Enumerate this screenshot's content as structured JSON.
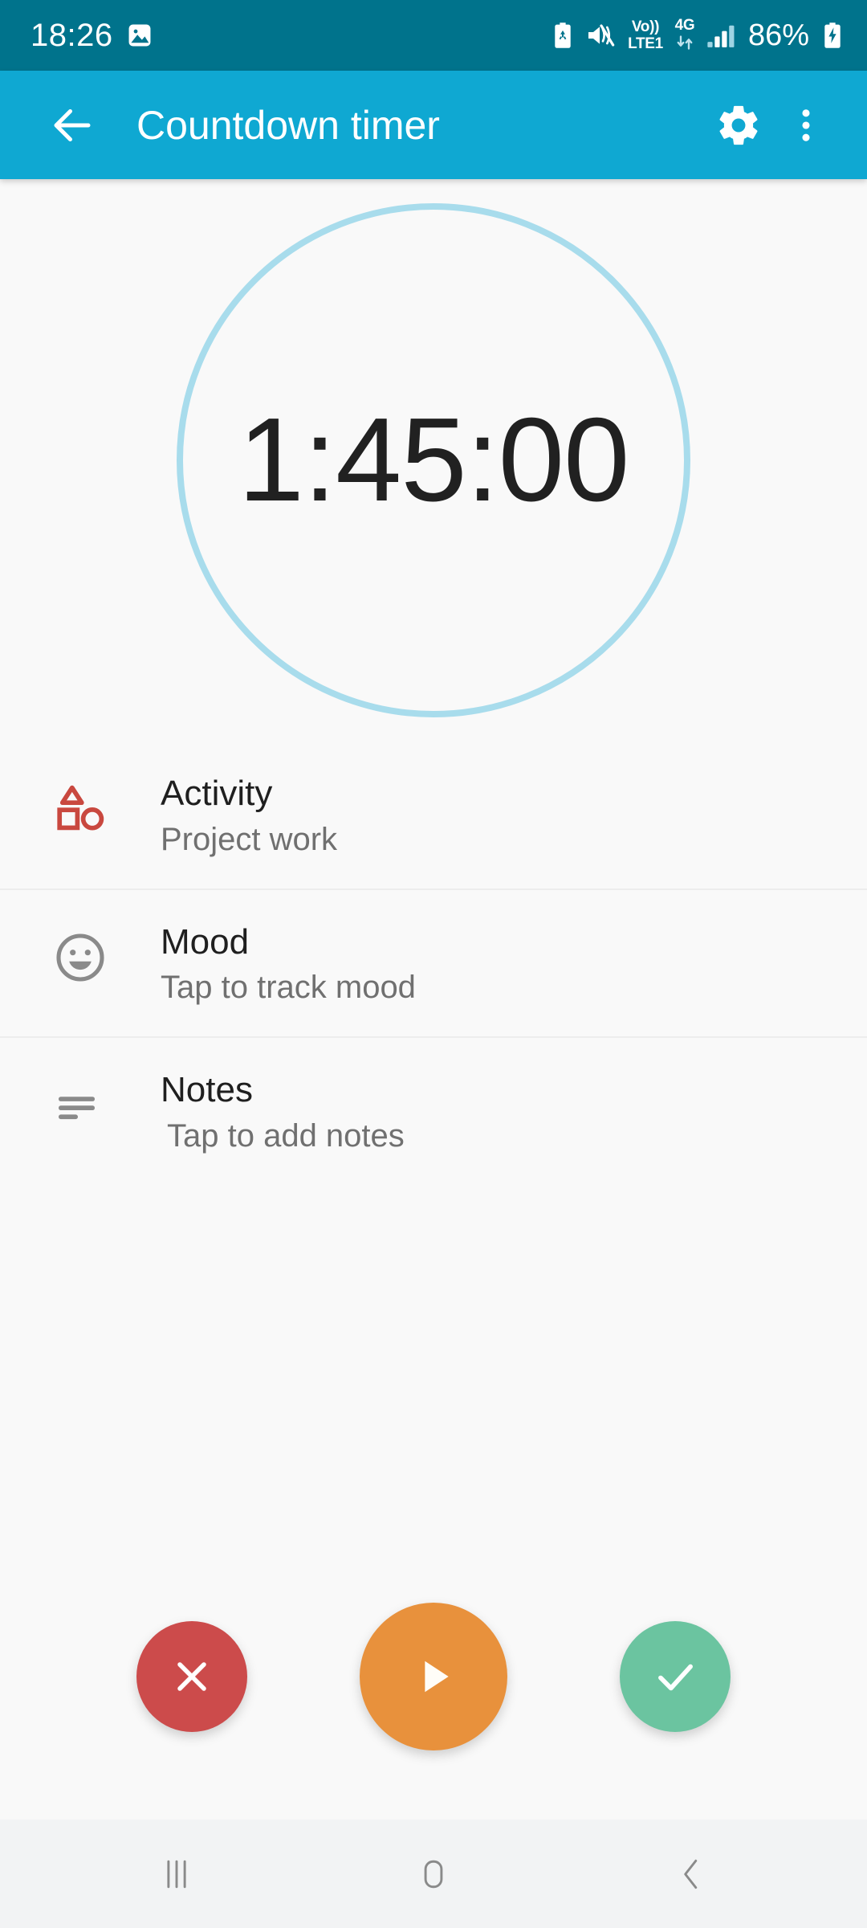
{
  "status_bar": {
    "time": "18:26",
    "icons": [
      {
        "name": "photos-icon"
      },
      {
        "name": "battery-saver-icon"
      },
      {
        "name": "vibrate-mute-icon"
      },
      {
        "name": "volte-icon"
      },
      {
        "name": "network-4g-icon"
      },
      {
        "name": "signal-bars-icon"
      }
    ],
    "volte_line1": "Vo))",
    "volte_line2": "LTE1",
    "network_type": "4G",
    "battery_percent": "86%",
    "charging": true
  },
  "app_bar": {
    "back_label": "Back",
    "title": "Countdown timer",
    "settings_label": "Settings",
    "overflow_label": "More options"
  },
  "timer": {
    "display": "1:45:00",
    "ring_color": "#a8dcec"
  },
  "rows": [
    {
      "icon": "category-icon",
      "title": "Activity",
      "subtitle": "Project work",
      "icon_color": "#c9483f"
    },
    {
      "icon": "mood-smiley-icon",
      "title": "Mood",
      "subtitle": "Tap to track mood",
      "icon_color": "#8a8a8a"
    },
    {
      "icon": "notes-lines-icon",
      "title": "Notes",
      "subtitle": "Tap to add notes",
      "icon_color": "#8a8a8a"
    }
  ],
  "actions": {
    "cancel": {
      "name": "cancel-button",
      "label": "Cancel",
      "color": "#cc4b4b"
    },
    "play": {
      "name": "play-button",
      "label": "Start",
      "color": "#e8913c"
    },
    "done": {
      "name": "done-button",
      "label": "Done",
      "color": "#6bc4a0"
    }
  },
  "nav_bar": {
    "recents_label": "Recents",
    "home_label": "Home",
    "back_label": "Back"
  },
  "theme": {
    "status_bar_bg": "#00738c",
    "app_bar_bg": "#0fa8d2",
    "page_bg": "#f9f9f9",
    "nav_bar_bg": "#f2f3f4",
    "divider": "#ededed",
    "title_text": "#1f1f1f",
    "subtitle_text": "#707070"
  }
}
